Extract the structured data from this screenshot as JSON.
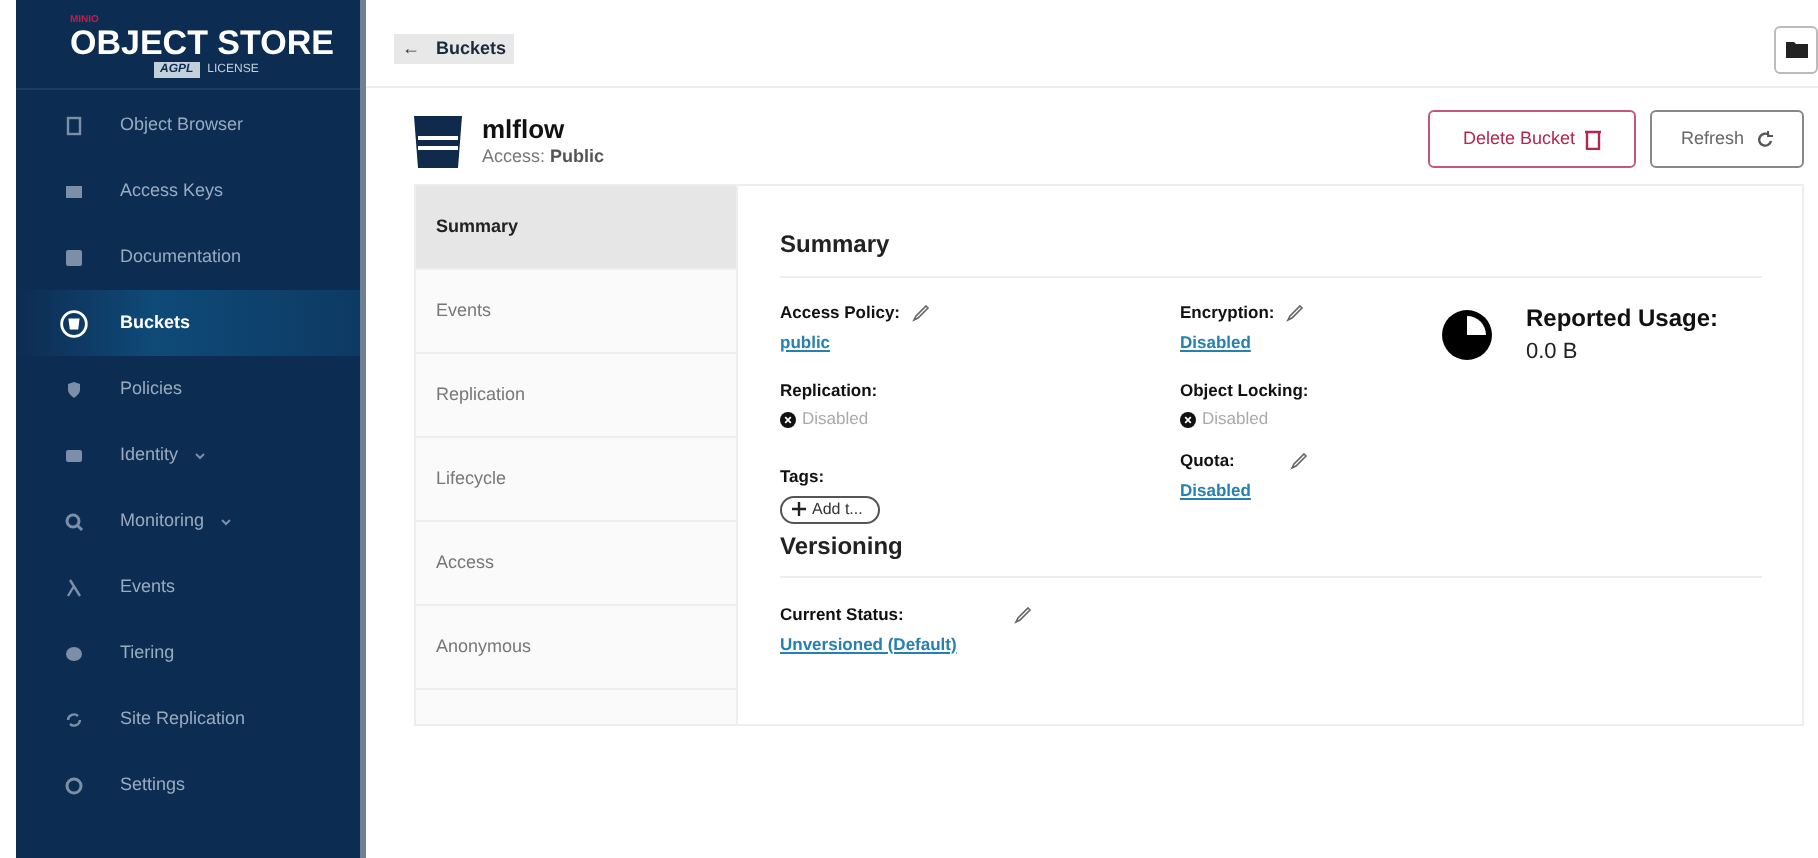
{
  "logo": {
    "brand": "MINIO",
    "product": "OBJECT STORE",
    "badge": "AGPL",
    "license": "LICENSE"
  },
  "sidebar": {
    "items": [
      {
        "label": "Object Browser",
        "kind": "link",
        "selected": false
      },
      {
        "label": "Access Keys",
        "kind": "link",
        "selected": false
      },
      {
        "label": "Documentation",
        "kind": "link",
        "selected": false
      },
      {
        "label": "Buckets",
        "kind": "link",
        "selected": true
      },
      {
        "label": "Policies",
        "kind": "link",
        "selected": false
      },
      {
        "label": "Identity",
        "kind": "group",
        "selected": false
      },
      {
        "label": "Monitoring",
        "kind": "group",
        "selected": false
      },
      {
        "label": "Events",
        "kind": "link",
        "selected": false
      },
      {
        "label": "Tiering",
        "kind": "link",
        "selected": false
      },
      {
        "label": "Site Replication",
        "kind": "link",
        "selected": false
      },
      {
        "label": "Settings",
        "kind": "link",
        "selected": false
      }
    ]
  },
  "breadcrumb": {
    "back": "←",
    "label": "Buckets"
  },
  "bucket": {
    "name": "mlflow",
    "access_label": "Access:",
    "access": "Public"
  },
  "actions": [
    {
      "label": "Delete Bucket",
      "kind": "danger"
    },
    {
      "label": "Refresh",
      "kind": "plain"
    }
  ],
  "tabs": [
    {
      "label": "Summary",
      "selected": true
    },
    {
      "label": "Events",
      "selected": false
    },
    {
      "label": "Replication",
      "selected": false
    },
    {
      "label": "Lifecycle",
      "selected": false
    },
    {
      "label": "Access",
      "selected": false
    },
    {
      "label": "Anonymous",
      "selected": false
    }
  ],
  "summary": {
    "title": "Summary",
    "access_policy": {
      "label": "Access Policy:",
      "value": "public"
    },
    "replication": {
      "label": "Replication:",
      "value": "Disabled"
    },
    "tags": {
      "label": "Tags:",
      "add": "Add t..."
    },
    "encryption": {
      "label": "Encryption:",
      "value": "Disabled"
    },
    "object_locking": {
      "label": "Object Locking:",
      "value": "Disabled"
    },
    "quota": {
      "label": "Quota:",
      "value": "Disabled"
    },
    "usage": {
      "label": "Reported Usage:",
      "value": "0.0 B"
    }
  },
  "versioning": {
    "title": "Versioning",
    "label": "Current Status:",
    "value": "Unversioned (Default)"
  }
}
